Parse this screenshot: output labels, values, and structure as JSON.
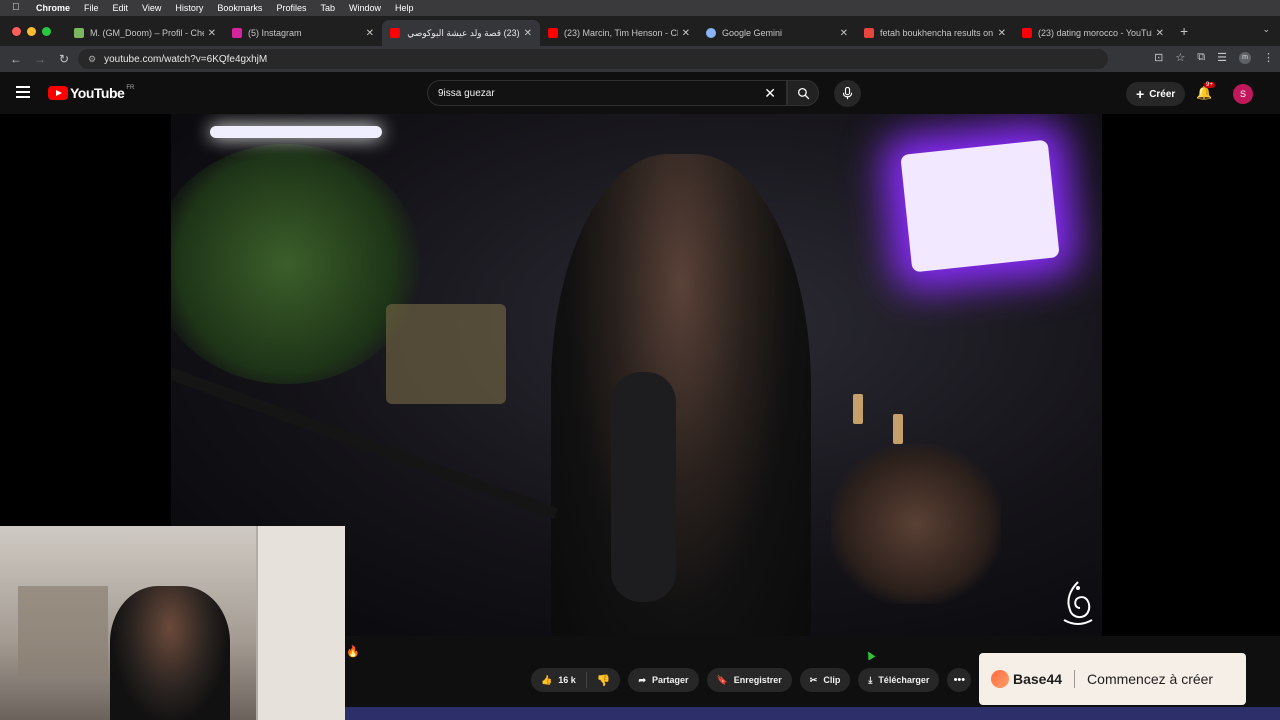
{
  "menubar": {
    "app": "Chrome",
    "items": [
      "File",
      "Edit",
      "View",
      "History",
      "Bookmarks",
      "Profiles",
      "Tab",
      "Window",
      "Help"
    ]
  },
  "tabs": [
    {
      "title": "M. (GM_Doom) – Profil - Che",
      "favicon_color": "#7bb661",
      "active": false
    },
    {
      "title": "(5) Instagram",
      "favicon_color": "#d6249f",
      "active": false
    },
    {
      "title": "(23) قصة ولد عيشة البوكوصي",
      "favicon_color": "#ff0000",
      "active": true
    },
    {
      "title": "(23) Marcin, Tim Henson - Ch",
      "favicon_color": "#ff0000",
      "active": false
    },
    {
      "title": "Google Gemini",
      "favicon_color": "#8ab4f8",
      "active": false
    },
    {
      "title": "fetah boukhencha results on",
      "favicon_color": "#e8453c",
      "active": false
    },
    {
      "title": "(23) dating morocco - YouTub",
      "favicon_color": "#ff0000",
      "active": false
    }
  ],
  "address": {
    "url": "youtube.com/watch?v=6KQfe4gxhjM"
  },
  "youtube": {
    "logo_text": "YouTube",
    "country": "FR",
    "search_value": "9issa guezar",
    "create_label": "Créer",
    "notif_badge": "9+",
    "avatar_letter": "S"
  },
  "actions": {
    "likes": "16 k",
    "share": "Partager",
    "save": "Enregistrer",
    "clip": "Clip",
    "download": "Télécharger"
  },
  "ad": {
    "brand": "Base44",
    "cta": "Commencez à créer"
  }
}
